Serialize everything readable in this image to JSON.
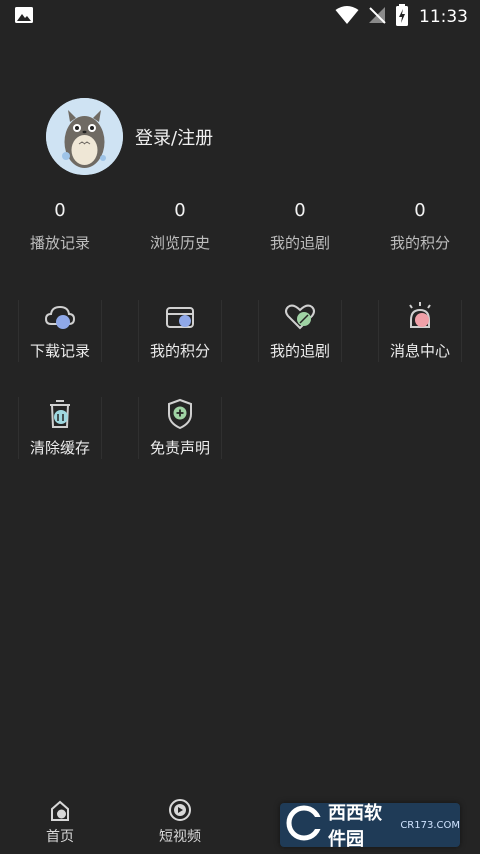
{
  "status_bar": {
    "time": "11:33"
  },
  "profile": {
    "login_label": "登录/注册"
  },
  "stats": [
    {
      "value": "0",
      "label": "播放记录"
    },
    {
      "value": "0",
      "label": "浏览历史"
    },
    {
      "value": "0",
      "label": "我的追剧"
    },
    {
      "value": "0",
      "label": "我的积分"
    }
  ],
  "grid": [
    {
      "label": "下载记录",
      "icon": "cloud-download-icon"
    },
    {
      "label": "我的积分",
      "icon": "points-card-icon"
    },
    {
      "label": "我的追剧",
      "icon": "heart-follow-icon"
    },
    {
      "label": "消息中心",
      "icon": "bell-icon"
    },
    {
      "label": "清除缓存",
      "icon": "trash-icon"
    },
    {
      "label": "免责声明",
      "icon": "shield-plus-icon"
    }
  ],
  "bottom_nav": [
    {
      "label": "首页",
      "icon": "home-icon"
    },
    {
      "label": "短视频",
      "icon": "play-circle-icon"
    }
  ],
  "watermark": {
    "text": "西西软件园",
    "sub": "CR173.COM"
  }
}
